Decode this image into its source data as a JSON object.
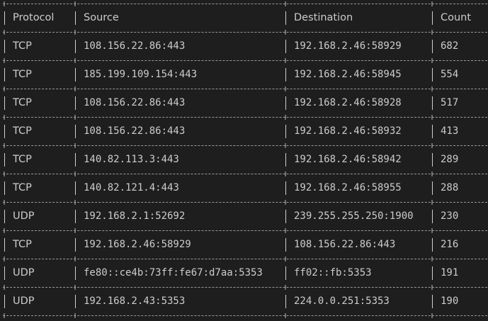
{
  "table": {
    "headers": {
      "protocol": "Protocol",
      "source": "Source",
      "destination": "Destination",
      "count": "Count"
    },
    "rows": [
      {
        "protocol": "TCP",
        "source": "108.156.22.86:443",
        "destination": "192.168.2.46:58929",
        "count": "682"
      },
      {
        "protocol": "TCP",
        "source": "185.199.109.154:443",
        "destination": "192.168.2.46:58945",
        "count": "554"
      },
      {
        "protocol": "TCP",
        "source": "108.156.22.86:443",
        "destination": "192.168.2.46:58928",
        "count": "517"
      },
      {
        "protocol": "TCP",
        "source": "108.156.22.86:443",
        "destination": "192.168.2.46:58932",
        "count": "413"
      },
      {
        "protocol": "TCP",
        "source": "140.82.113.3:443",
        "destination": "192.168.2.46:58942",
        "count": "289"
      },
      {
        "protocol": "TCP",
        "source": "140.82.121.4:443",
        "destination": "192.168.2.46:58955",
        "count": "288"
      },
      {
        "protocol": "UDP",
        "source": "192.168.2.1:52692",
        "destination": "239.255.255.250:1900",
        "count": "230"
      },
      {
        "protocol": "TCP",
        "source": "192.168.2.46:58929",
        "destination": "108.156.22.86:443",
        "count": "216"
      },
      {
        "protocol": "UDP",
        "source": "fe80::ce4b:73ff:fe67:d7aa:5353",
        "destination": "ff02::fb:5353",
        "count": "191"
      },
      {
        "protocol": "UDP",
        "source": "192.168.2.43:5353",
        "destination": "224.0.0.251:5353",
        "count": "190"
      }
    ]
  }
}
